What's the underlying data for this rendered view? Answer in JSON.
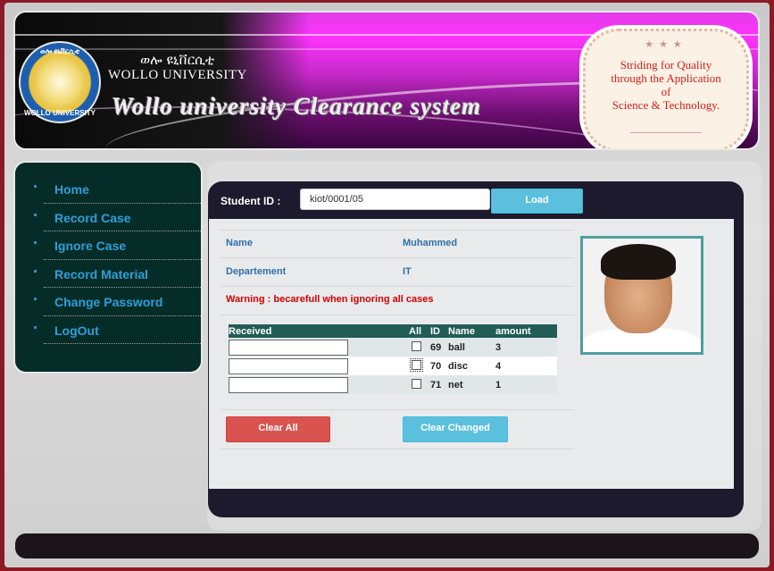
{
  "header": {
    "logo_top_text": "ወሎ ዩኒቨርሲቲ",
    "logo_bottom_text": "WOLLO UNIVERSITY",
    "amharic_name": "ወሎ ዩኒቨርሲቲ",
    "university_name": "WOLLO UNIVERSITY",
    "system_title": "Wollo university Clearance system",
    "badge_stars": "★★★",
    "motto_lines": [
      "Striding for Quality",
      "through the Application",
      "of",
      "Science & Technology."
    ]
  },
  "sidebar": {
    "items": [
      {
        "label": "Home"
      },
      {
        "label": "Record Case"
      },
      {
        "label": "Ignore Case"
      },
      {
        "label": "Record Material"
      },
      {
        "label": "Change Password"
      },
      {
        "label": "LogOut"
      }
    ]
  },
  "form": {
    "student_id_label": "Student ID :",
    "student_id_value": "kiot/0001/05",
    "load_label": "Load"
  },
  "info": {
    "name_label": "Name",
    "name_value": "Muhammed",
    "dept_label": "Departement",
    "dept_value": "IT",
    "warning": "Warning : becarefull when ignoring all cases"
  },
  "table": {
    "headers": {
      "received": "Received",
      "all": "All",
      "id": "ID",
      "name": "Name",
      "amount": "amount"
    },
    "rows": [
      {
        "id": "69",
        "name": "ball",
        "amount": "3"
      },
      {
        "id": "70",
        "name": "disc",
        "amount": "4"
      },
      {
        "id": "71",
        "name": "net",
        "amount": "1"
      }
    ]
  },
  "actions": {
    "clear_all": "Clear All",
    "clear_changed": "Clear Changed"
  },
  "colors": {
    "accent_blue": "#5bc0de",
    "danger_red": "#d9534f",
    "sidebar_bg": "#062c28",
    "table_header": "#215d55",
    "link_blue": "#2e9fd9"
  }
}
